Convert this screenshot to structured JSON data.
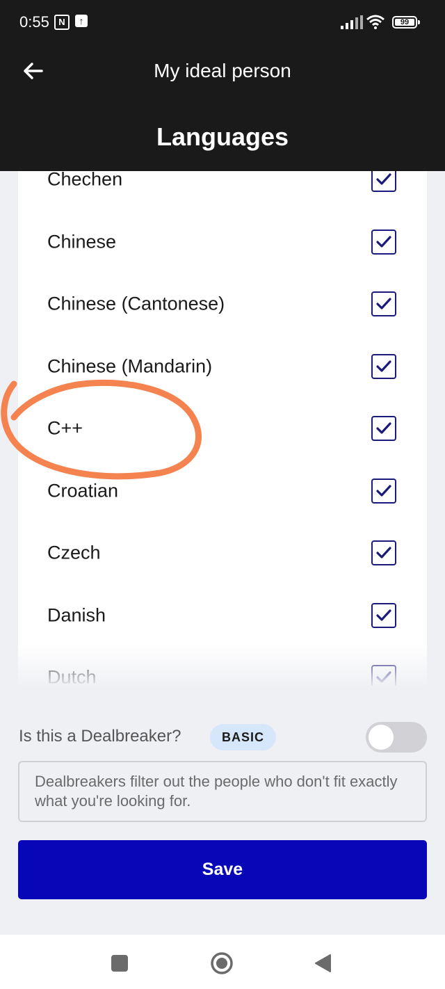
{
  "status": {
    "time": "0:55",
    "nfc_glyph": "N",
    "upload_glyph": "↑",
    "battery": "99",
    "icons": [
      "nfc-icon",
      "upload-icon",
      "signal-icon",
      "wifi-icon",
      "battery-icon"
    ]
  },
  "header": {
    "back_icon": "arrow-left-icon",
    "nav_title": "My ideal person",
    "page_title": "Languages"
  },
  "languages": [
    {
      "label": "Chechen",
      "checked": true
    },
    {
      "label": "Chinese",
      "checked": true
    },
    {
      "label": "Chinese (Cantonese)",
      "checked": true
    },
    {
      "label": "Chinese (Mandarin)",
      "checked": true
    },
    {
      "label": "C++",
      "checked": true
    },
    {
      "label": "Croatian",
      "checked": true
    },
    {
      "label": "Czech",
      "checked": true
    },
    {
      "label": "Danish",
      "checked": true
    },
    {
      "label": "Dutch",
      "checked": true
    }
  ],
  "annotation": {
    "color": "#f4834f",
    "target": "C++"
  },
  "dealbreaker": {
    "label": "Is this a Dealbreaker?",
    "badge": "BASIC",
    "toggle_on": false,
    "info": "Dealbreakers filter out the people who don't fit exactly what you're looking for."
  },
  "save_label": "Save",
  "colors": {
    "accent": "#0707b8",
    "checkbox": "#1a1a7a",
    "header_bg": "#1a1a1a"
  },
  "bottom_nav": [
    "recent-apps-icon",
    "home-icon",
    "back-icon"
  ]
}
